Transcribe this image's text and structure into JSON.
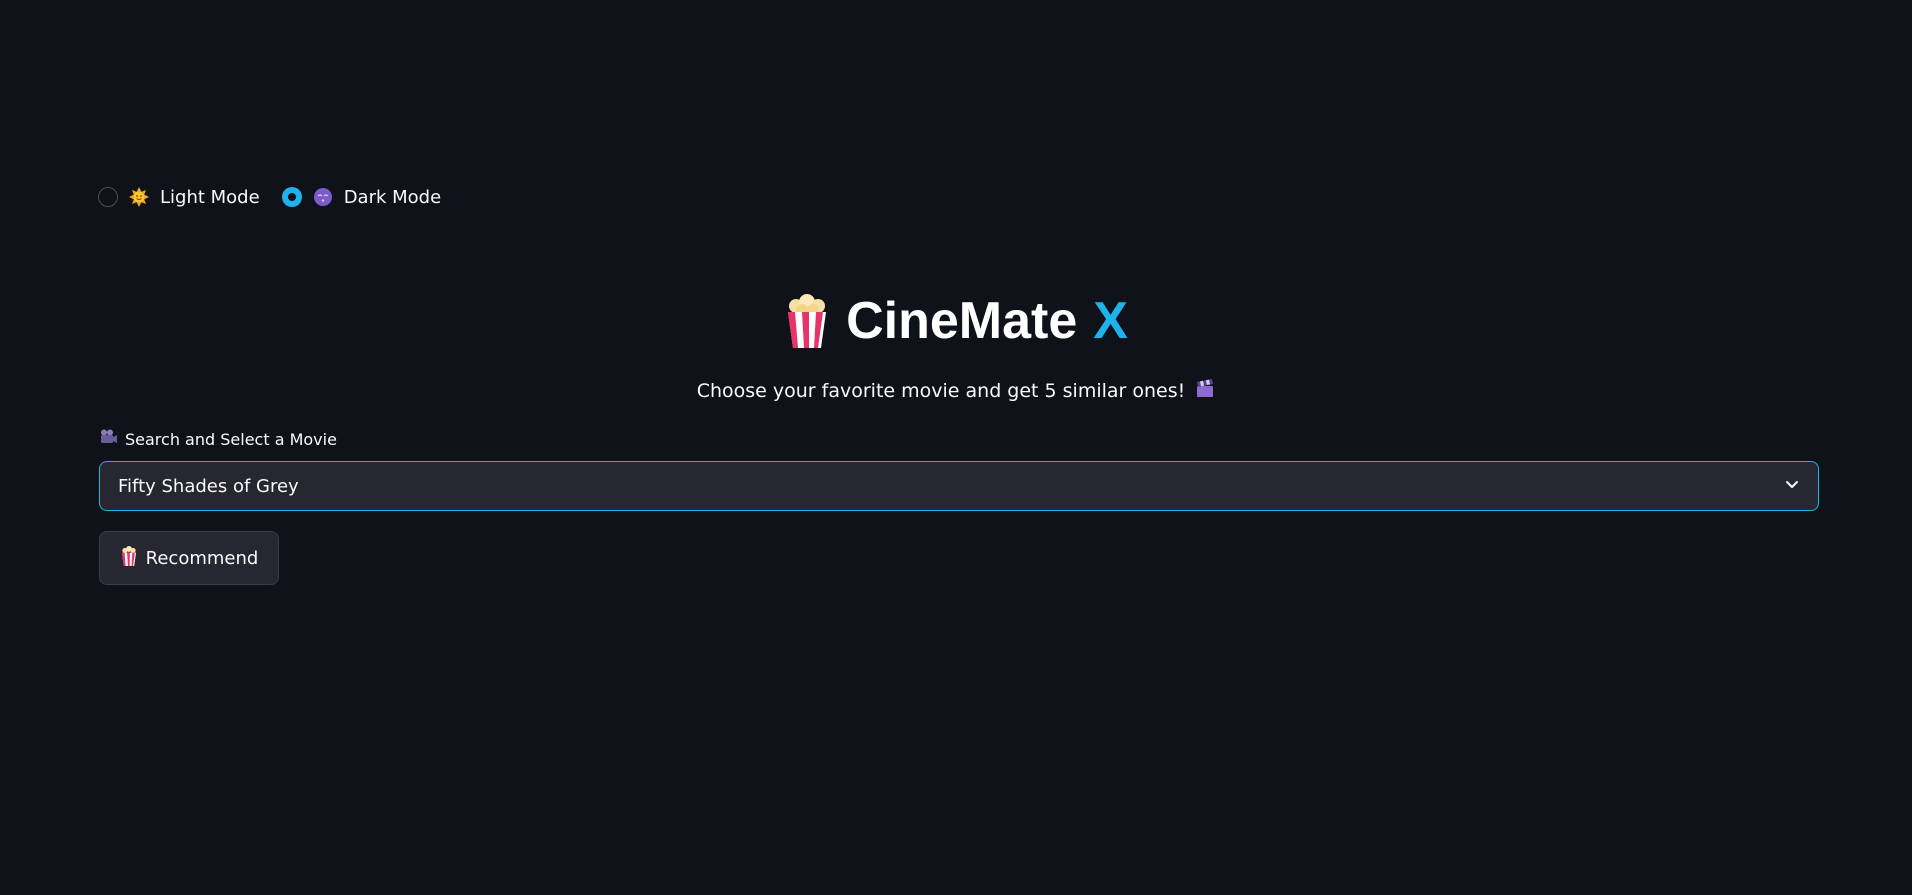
{
  "theme_toggle": {
    "options": [
      {
        "label": "Light Mode",
        "icon": "sun-face-icon",
        "selected": false
      },
      {
        "label": "Dark Mode",
        "icon": "crescent-moon-face-icon",
        "selected": true
      }
    ]
  },
  "header": {
    "title_main": "CineMate",
    "title_accent": "X",
    "icon": "popcorn-icon",
    "subtitle": "Choose your favorite movie and get 5 similar ones!",
    "subtitle_icon": "clapper-board-icon"
  },
  "movie_select": {
    "label": "Search and Select a Movie",
    "label_icon": "movie-camera-icon",
    "selected_value": "Fifty Shades of Grey"
  },
  "recommend_button": {
    "label": "Recommend",
    "icon": "popcorn-icon"
  },
  "colors": {
    "background": "#10121a",
    "accent": "#1fb3ec",
    "surface": "#262730"
  }
}
